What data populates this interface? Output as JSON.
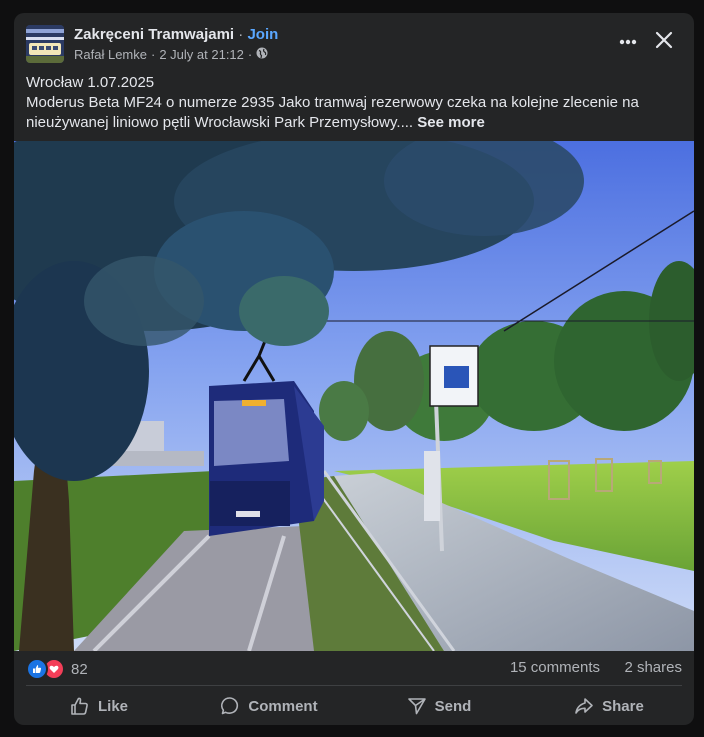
{
  "post": {
    "group_name": "Zakręceni Tramwajami",
    "separator": "·",
    "join_label": "Join",
    "author": "Rafał Lemke",
    "meta_sep": "·",
    "date": "2 July at 21:12",
    "meta_sep2": "·",
    "privacy_icon": "globe-icon",
    "text_line1": "Wrocław 1.07.2025",
    "text_body": "Moderus Beta MF24 o numerze 2935 Jako tramwaj rezerwowy czeka na kolejne zlecenie na nieużywanej liniowo pętli Wrocławski Park Przemysłowy....",
    "see_more": "See more"
  },
  "stats": {
    "reaction_icons": [
      "like-icon",
      "love-icon"
    ],
    "reaction_count": "82",
    "comments": "15 comments",
    "shares": "2 shares"
  },
  "actions": [
    {
      "label": "Like",
      "icon": "thumbs-up-icon"
    },
    {
      "label": "Comment",
      "icon": "comment-icon"
    },
    {
      "label": "Send",
      "icon": "send-icon"
    },
    {
      "label": "Share",
      "icon": "share-icon"
    }
  ],
  "colors": {
    "background": "#0f0f10",
    "card": "#242526",
    "text_primary": "#e4e6eb",
    "text_secondary": "#b0b3b8",
    "link": "#5aa7ff",
    "like_blue": "#1b74e4",
    "love_red": "#f33e58"
  }
}
